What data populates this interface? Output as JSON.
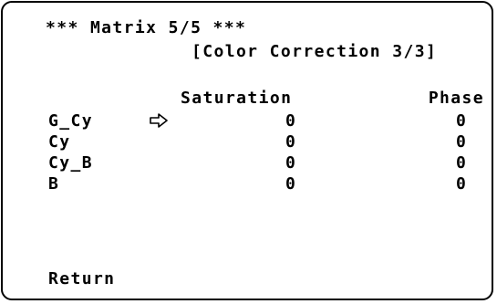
{
  "menu": {
    "title": "*** Matrix 5/5 ***",
    "subtitle": "[Color Correction 3/3]",
    "columns": {
      "saturation": "Saturation",
      "phase": "Phase"
    },
    "rows": [
      {
        "label": "G_Cy",
        "saturation": "0",
        "phase": "0",
        "selected": true
      },
      {
        "label": "Cy",
        "saturation": "0",
        "phase": "0",
        "selected": false
      },
      {
        "label": "Cy_B",
        "saturation": "0",
        "phase": "0",
        "selected": false
      },
      {
        "label": "B",
        "saturation": "0",
        "phase": "0",
        "selected": false
      }
    ],
    "cursor_icon": "pointer-arrow-icon",
    "return_label": "Return"
  }
}
